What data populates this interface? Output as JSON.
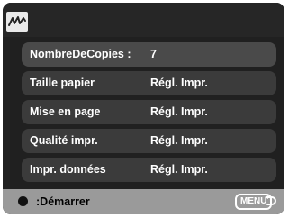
{
  "tab": {
    "icon": "print-wave-icon"
  },
  "menu": {
    "items": [
      {
        "label": "NombreDeCopies :",
        "value": "7"
      },
      {
        "label": "Taille papier",
        "value": "Régl. Impr."
      },
      {
        "label": "Mise en page",
        "value": "Régl. Impr."
      },
      {
        "label": "Qualité impr.",
        "value": "Régl. Impr."
      },
      {
        "label": "Impr. données",
        "value": "Régl. Impr."
      }
    ]
  },
  "footer": {
    "start_label": ":Démarrer",
    "menu_key_label": "MENU",
    "back_icon": "return-arrow-icon"
  }
}
